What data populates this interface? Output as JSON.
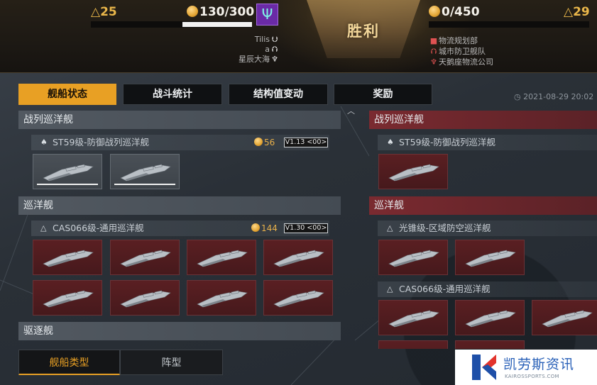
{
  "header": {
    "left_level": "△25",
    "right_level": "△29",
    "left_resource": "130/300",
    "left_resource_fill": 0.433,
    "right_resource": "0/450",
    "right_resource_fill": 0,
    "result": "胜利",
    "left_players": [
      {
        "name": "Tilis",
        "symbol": "⮋"
      },
      {
        "name": "a",
        "symbol": "⮉"
      },
      {
        "name": "星辰大海",
        "symbol": "♆"
      }
    ],
    "right_players": [
      {
        "name": "物流规划部",
        "symbol": "■"
      },
      {
        "name": "城市防卫舰队",
        "symbol": "⮉"
      },
      {
        "name": "天鹅座物流公司",
        "symbol": "♆"
      }
    ]
  },
  "tabs": [
    "舰船状态",
    "战斗统计",
    "结构值变动",
    "奖励"
  ],
  "active_tab": 0,
  "timestamp": "2021-08-29 20:02",
  "left_panel": {
    "sections": [
      {
        "category": "战列巡洋舰",
        "ship_class": "ST59级-防御战列巡洋舰",
        "cost": "56",
        "version": "V1.13 <00>",
        "cards": [
          "grey",
          "grey"
        ]
      },
      {
        "category": "巡洋舰",
        "ship_class": "CAS066级-通用巡洋舰",
        "cost": "144",
        "version": "V1.30 <00>",
        "cards": [
          "red",
          "red",
          "red",
          "red",
          "red",
          "red",
          "red",
          "red"
        ]
      },
      {
        "category": "驱逐舰"
      }
    ]
  },
  "right_panel": {
    "sections": [
      {
        "category": "战列巡洋舰",
        "ship_class": "ST59级-防御战列巡洋舰",
        "cards": [
          "red"
        ]
      },
      {
        "category": "巡洋舰",
        "ship_classes": [
          "光锥级-区域防空巡洋舰",
          "CAS066级-通用巡洋舰"
        ],
        "cards_a": [
          "red",
          "red"
        ],
        "cards_b": [
          "red",
          "red",
          "red"
        ]
      }
    ]
  },
  "bottom_tabs": [
    "舰船类型",
    "阵型"
  ],
  "watermark": {
    "main": "凯劳斯资讯",
    "sub": "KAIROSSPORTS.COM"
  },
  "colors": {
    "accent": "#e8a024",
    "gold": "#e9b64a",
    "enemy_red": "#7a2a30"
  }
}
